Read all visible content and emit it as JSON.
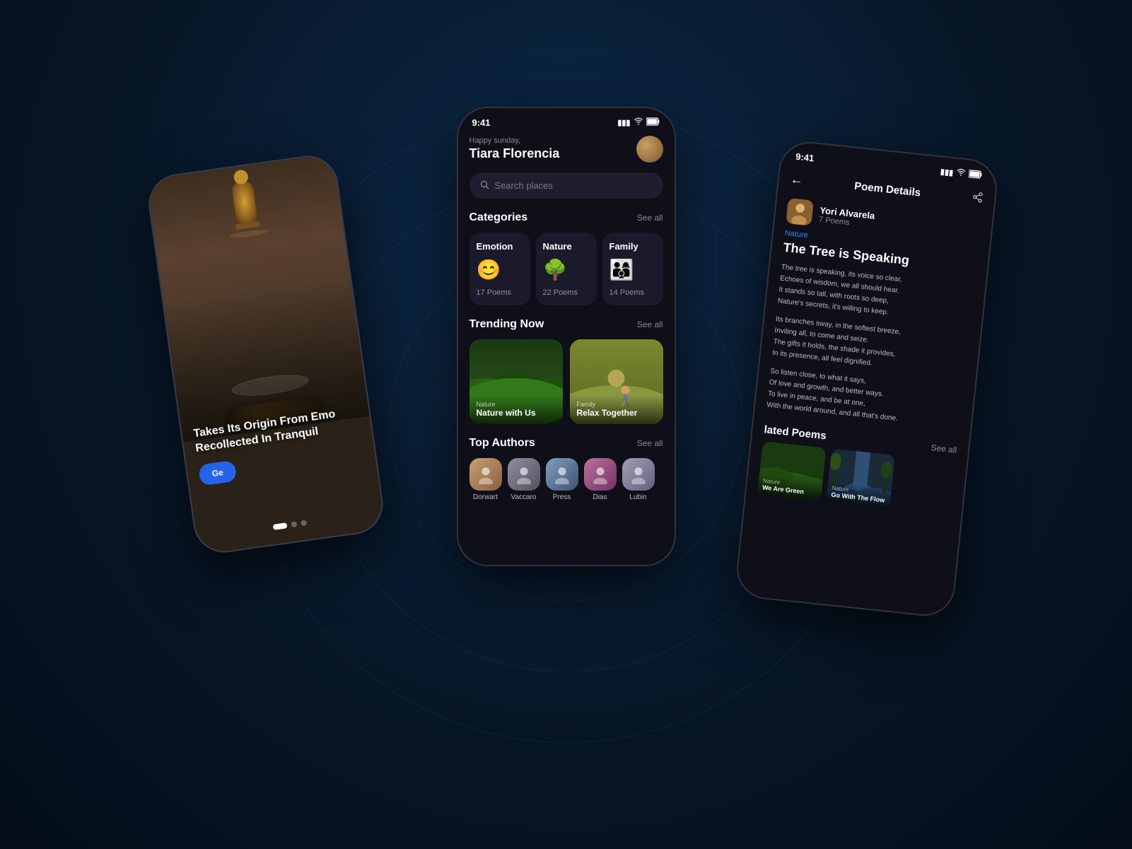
{
  "background": {
    "gradient_start": "#0d2a4a",
    "gradient_end": "#040e1a"
  },
  "phone_left": {
    "title": "Takes Its Origin From Emo Recollected In Tranquil",
    "button_label": "Ge",
    "dots": [
      "active",
      "inactive",
      "inactive"
    ],
    "image_description": "Oil lamp on book with lace"
  },
  "phone_center": {
    "status_bar": {
      "time": "9:41",
      "signal": "▮▮▮",
      "wifi": "WiFi",
      "battery": "Battery"
    },
    "greeting": "Happy sunday,",
    "user_name": "Tiara Florencia",
    "search": {
      "placeholder": "Search places"
    },
    "categories_section": {
      "title": "Categories",
      "see_all": "See all",
      "items": [
        {
          "name": "Emotion",
          "icon": "😊",
          "count": "17 Poems",
          "icon_color": "#f0c030"
        },
        {
          "name": "Nature",
          "icon": "🌳",
          "count": "22 Poems",
          "icon_color": "#30a030"
        },
        {
          "name": "Family",
          "icon": "👨‍👩‍👦",
          "count": "14 Poems",
          "icon_color": "#c030c0"
        }
      ]
    },
    "trending_section": {
      "title": "Trending Now",
      "see_all": "See all",
      "items": [
        {
          "category": "Nature",
          "title": "Nature with Us",
          "bg": "nature"
        },
        {
          "category": "Family",
          "title": "Relax Together",
          "bg": "family"
        }
      ]
    },
    "authors_section": {
      "title": "Top Authors",
      "see_all": "See all",
      "authors": [
        {
          "name": "Dorwart"
        },
        {
          "name": "Vaccaro"
        },
        {
          "name": "Press"
        },
        {
          "name": "Dias"
        },
        {
          "name": "Lubin"
        }
      ]
    }
  },
  "phone_right": {
    "status_bar": {
      "time": "9:41"
    },
    "header_title": "Poem Details",
    "author": {
      "name": "Yori Alvarela",
      "poems_count": "7 Poems"
    },
    "poem_category": "Nature",
    "poem_title": "The Tree is Speaking",
    "poem_stanzas": [
      "The tree is speaking, its voice so clear,\nEchoes of wisdom, we all should hear.\nIt stands so tall, with roots so deep,\nNature's secrets, it's willing to keep.",
      "Its branches sway, in the softest breeze,\nInviting all, to come and seize.\nThe gifts it holds, the shade it provides,\nIn its presence, all feel dignified.",
      "So listen close, to what it says,\nOf love and growth, and better ways.\nTo live in peace, and be at one,\nWith the world around, and all that's done."
    ],
    "related_section": {
      "title": "lated Poems",
      "see_all": "See all",
      "items": [
        {
          "category": "Nature",
          "title": "We Are Green",
          "bg": "green"
        },
        {
          "category": "Nature",
          "title": "Go With The Flow",
          "bg": "waterfall"
        }
      ]
    }
  }
}
